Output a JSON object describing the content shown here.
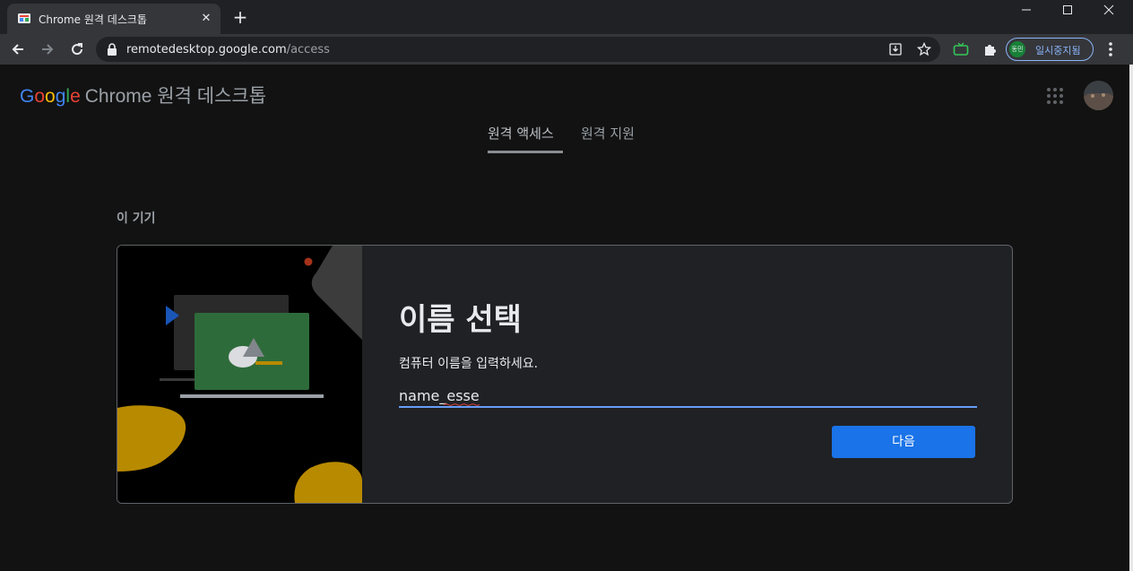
{
  "browser": {
    "tab": {
      "title": "Chrome 원격 데스크톱",
      "favicon": "remote-desktop-icon",
      "close": "✕"
    },
    "new_tab": "+",
    "window_controls": {
      "minimize": "minimize-icon",
      "maximize": "maximize-icon",
      "close": "close-icon"
    },
    "address": {
      "host": "remotedesktop.google.com",
      "path": "/access"
    },
    "profile": {
      "avatar_text": "동민",
      "label": "일시중지됨"
    }
  },
  "header": {
    "brand": {
      "google": [
        "G",
        "o",
        "o",
        "g",
        "l",
        "e"
      ],
      "rest": "Chrome 원격 데스크톱"
    }
  },
  "nav": {
    "tabs": [
      {
        "label": "원격 액세스",
        "active": true
      },
      {
        "label": "원격 지원",
        "active": false
      }
    ]
  },
  "main": {
    "section_title": "이 기기",
    "card": {
      "title": "이름 선택",
      "description": "컴퓨터 이름을 입력하세요.",
      "input_value": "name_esse",
      "next_label": "다음"
    }
  },
  "colors": {
    "accent": "#1a73e8",
    "input_underline": "#669df6",
    "illustration_green": "#2e6b3a",
    "illustration_gold": "#b88a00"
  }
}
